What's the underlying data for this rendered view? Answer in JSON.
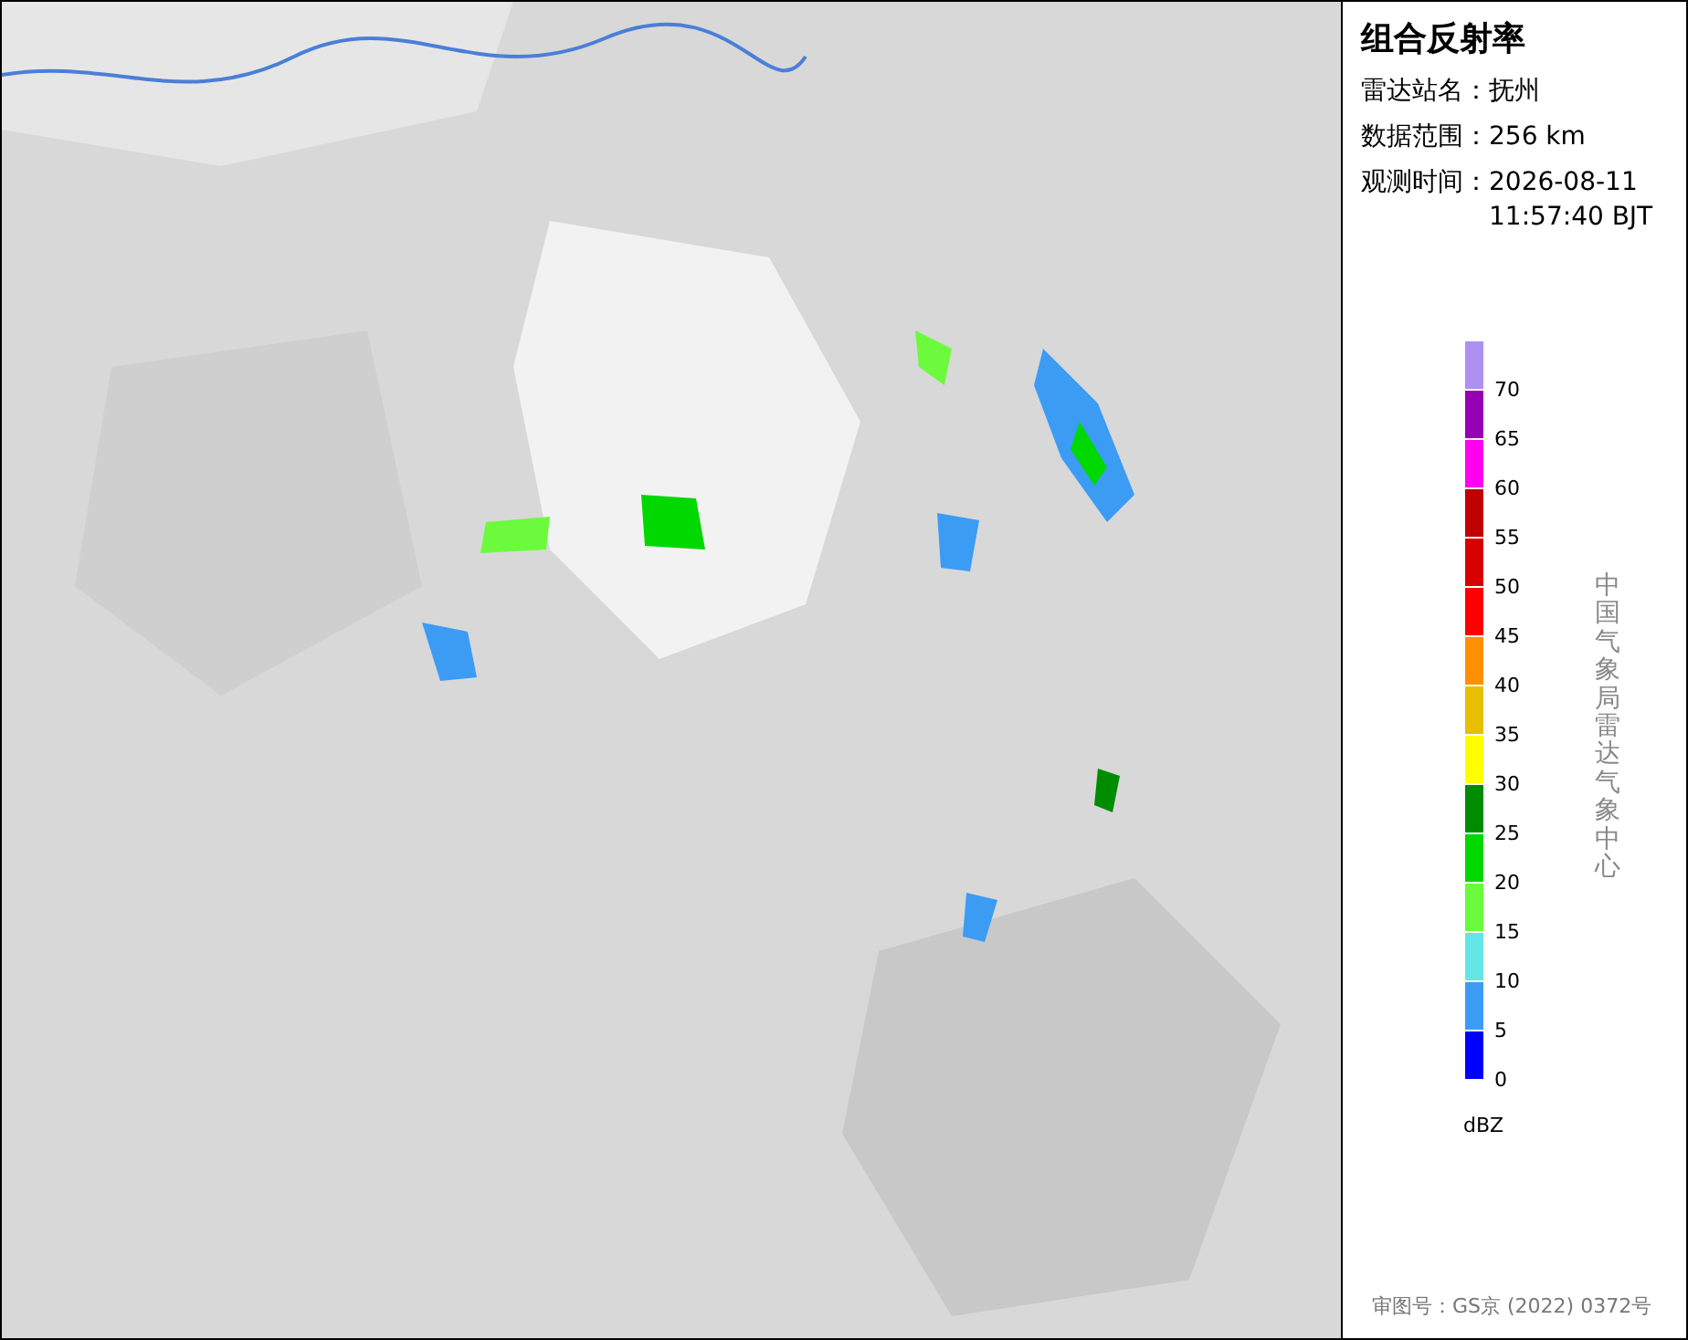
{
  "panel": {
    "title": "组合反射率",
    "info": [
      {
        "label": "雷达站名：",
        "values": [
          "抚州"
        ]
      },
      {
        "label": "数据范围：",
        "values": [
          "256 km"
        ]
      },
      {
        "label": "观测时间：",
        "values": [
          "2026-08-11",
          "11:57:40 BJT"
        ]
      }
    ],
    "legend": [
      {
        "label": "70",
        "color": "#ad90f0"
      },
      {
        "label": "65",
        "color": "#9600b4"
      },
      {
        "label": "60",
        "color": "#ff00f0"
      },
      {
        "label": "55",
        "color": "#c00000"
      },
      {
        "label": "50",
        "color": "#d60000"
      },
      {
        "label": "45",
        "color": "#ff0000"
      },
      {
        "label": "40",
        "color": "#ff9000"
      },
      {
        "label": "35",
        "color": "#e6c000"
      },
      {
        "label": "30",
        "color": "#ffff00"
      },
      {
        "label": "25",
        "color": "#008c00"
      },
      {
        "label": "20",
        "color": "#00d800"
      },
      {
        "label": "15",
        "color": "#6cfa3c"
      },
      {
        "label": "10",
        "color": "#64e6e6"
      },
      {
        "label": "5",
        "color": "#3c9cf4"
      },
      {
        "label": "0",
        "color": "#0000ff"
      }
    ],
    "unit": "dBZ",
    "credit": "中国气象局雷达气象中心",
    "approval": "审图号：GS京 (2022) 0372号"
  }
}
